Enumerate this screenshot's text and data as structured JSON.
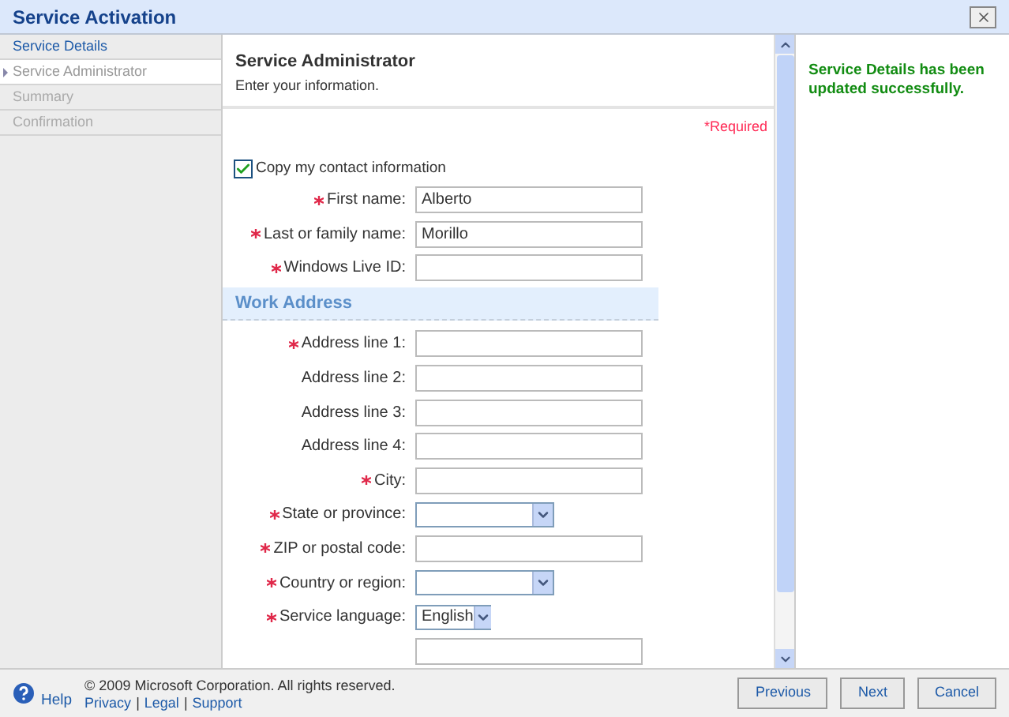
{
  "window": {
    "title": "Service Activation"
  },
  "steps": [
    {
      "label": "Service Details",
      "selected": false,
      "disabled": false
    },
    {
      "label": "Service Administrator",
      "selected": true,
      "disabled": false
    },
    {
      "label": "Summary",
      "selected": false,
      "disabled": true
    },
    {
      "label": "Confirmation",
      "selected": false,
      "disabled": true
    }
  ],
  "page": {
    "title": "Service Administrator",
    "subtitle": "Enter your information.",
    "required_note": "*Required"
  },
  "copy_contact": {
    "label": "Copy my contact information",
    "checked": true
  },
  "personal_fields": [
    {
      "kind": "text",
      "label": "First name:",
      "required": true,
      "value": "Alberto"
    },
    {
      "kind": "text",
      "label": "Last or family name:",
      "required": true,
      "value": "Morillo"
    },
    {
      "kind": "text",
      "label": "Windows Live ID:",
      "required": true
    }
  ],
  "section": {
    "title": "Work Address"
  },
  "address_fields": [
    {
      "kind": "text",
      "label": "Address line 1:",
      "required": true
    },
    {
      "kind": "text",
      "label": "Address line 2:",
      "required": false
    },
    {
      "kind": "text",
      "label": "Address line 3:",
      "required": false
    },
    {
      "kind": "text",
      "label": "Address line 4:",
      "required": false
    },
    {
      "kind": "text",
      "label": "City:",
      "required": true
    },
    {
      "kind": "select",
      "label": "State or province:",
      "required": true
    },
    {
      "kind": "text",
      "label": "ZIP or postal code:",
      "required": true
    },
    {
      "kind": "select",
      "label": "Country or region:",
      "required": true
    },
    {
      "kind": "select",
      "label": "Service language:",
      "required": true,
      "value": "English"
    },
    {
      "kind": "text"
    }
  ],
  "notice": "Service Details has been updated successfully.",
  "footer": {
    "help": "Help",
    "copyright": "© 2009 Microsoft Corporation. All rights reserved.",
    "links": [
      "Privacy",
      "Legal",
      "Support"
    ],
    "separator": "|"
  },
  "buttons": [
    "Previous",
    "Next",
    "Cancel"
  ]
}
